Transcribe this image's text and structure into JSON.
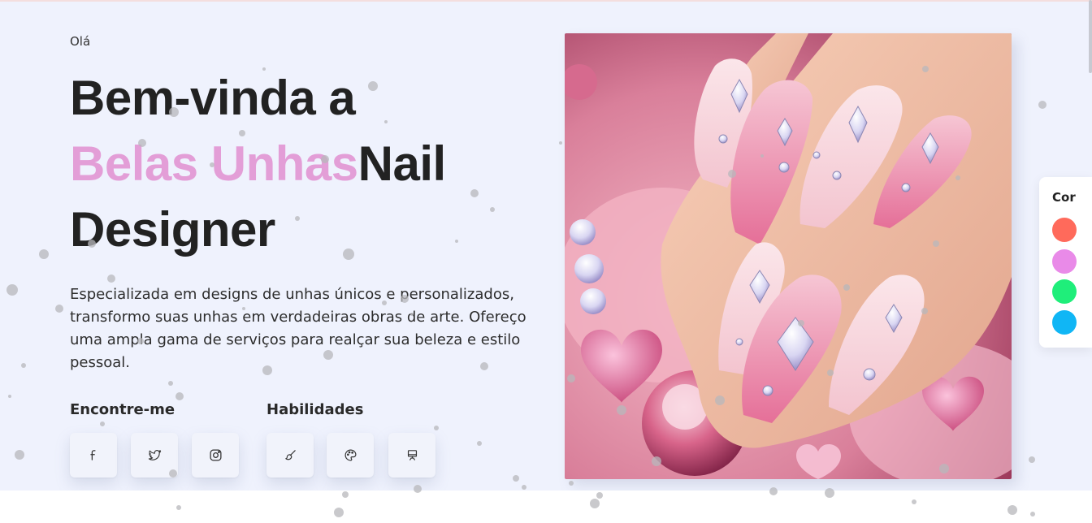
{
  "hero": {
    "greeting": "Olá",
    "title_line1": "Bem-vinda a",
    "title_accent": "Belas Unhas",
    "title_rest": "Nail",
    "title_line3": "Designer",
    "description": "Especializada em designs de unhas únicos e personalizados, transformo suas unhas em verdadeiras obras de arte. Ofereço uma ampla gama de serviços para realçar sua beleza e estilo pessoal."
  },
  "social": {
    "heading": "Encontre-me",
    "items": [
      {
        "icon": "facebook-icon"
      },
      {
        "icon": "twitter-icon"
      },
      {
        "icon": "instagram-icon"
      }
    ]
  },
  "skills": {
    "heading": "Habilidades",
    "items": [
      {
        "icon": "brush-icon"
      },
      {
        "icon": "palette-icon"
      },
      {
        "icon": "easel-icon"
      }
    ]
  },
  "color_panel": {
    "label": "Cor",
    "swatches": [
      "#ff6a5b",
      "#e98ae8",
      "#1fee7a",
      "#10b6f5"
    ]
  },
  "colors": {
    "accent": "#e39ed7",
    "background": "#eff2fd",
    "text": "#222222"
  }
}
